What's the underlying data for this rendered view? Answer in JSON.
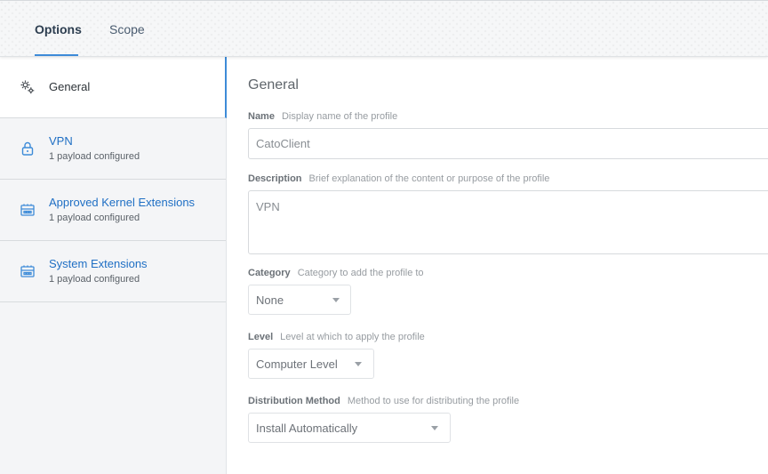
{
  "tabs": [
    {
      "label": "Options"
    },
    {
      "label": "Scope"
    }
  ],
  "sidebar": {
    "items": [
      {
        "label": "General",
        "icon": "gears-icon"
      },
      {
        "label": "VPN",
        "sub": "1 payload configured",
        "icon": "lock-icon"
      },
      {
        "label": "Approved Kernel Extensions",
        "sub": "1 payload configured",
        "icon": "extension-icon"
      },
      {
        "label": "System Extensions",
        "sub": "1 payload configured",
        "icon": "extension-icon"
      }
    ]
  },
  "main": {
    "title": "General",
    "name": {
      "label": "Name",
      "hint": "Display name of the profile",
      "value": "CatoClient"
    },
    "description": {
      "label": "Description",
      "hint": "Brief explanation of the content or purpose of the profile",
      "value": "VPN"
    },
    "category": {
      "label": "Category",
      "hint": "Category to add the profile to",
      "value": "None"
    },
    "level": {
      "label": "Level",
      "hint": "Level at which to apply the profile",
      "value": "Computer Level"
    },
    "distribution": {
      "label": "Distribution Method",
      "hint": "Method to use for distributing the profile",
      "value": "Install Automatically"
    }
  },
  "colors": {
    "accent": "#3d8bd8",
    "link": "#1f6fc4"
  }
}
